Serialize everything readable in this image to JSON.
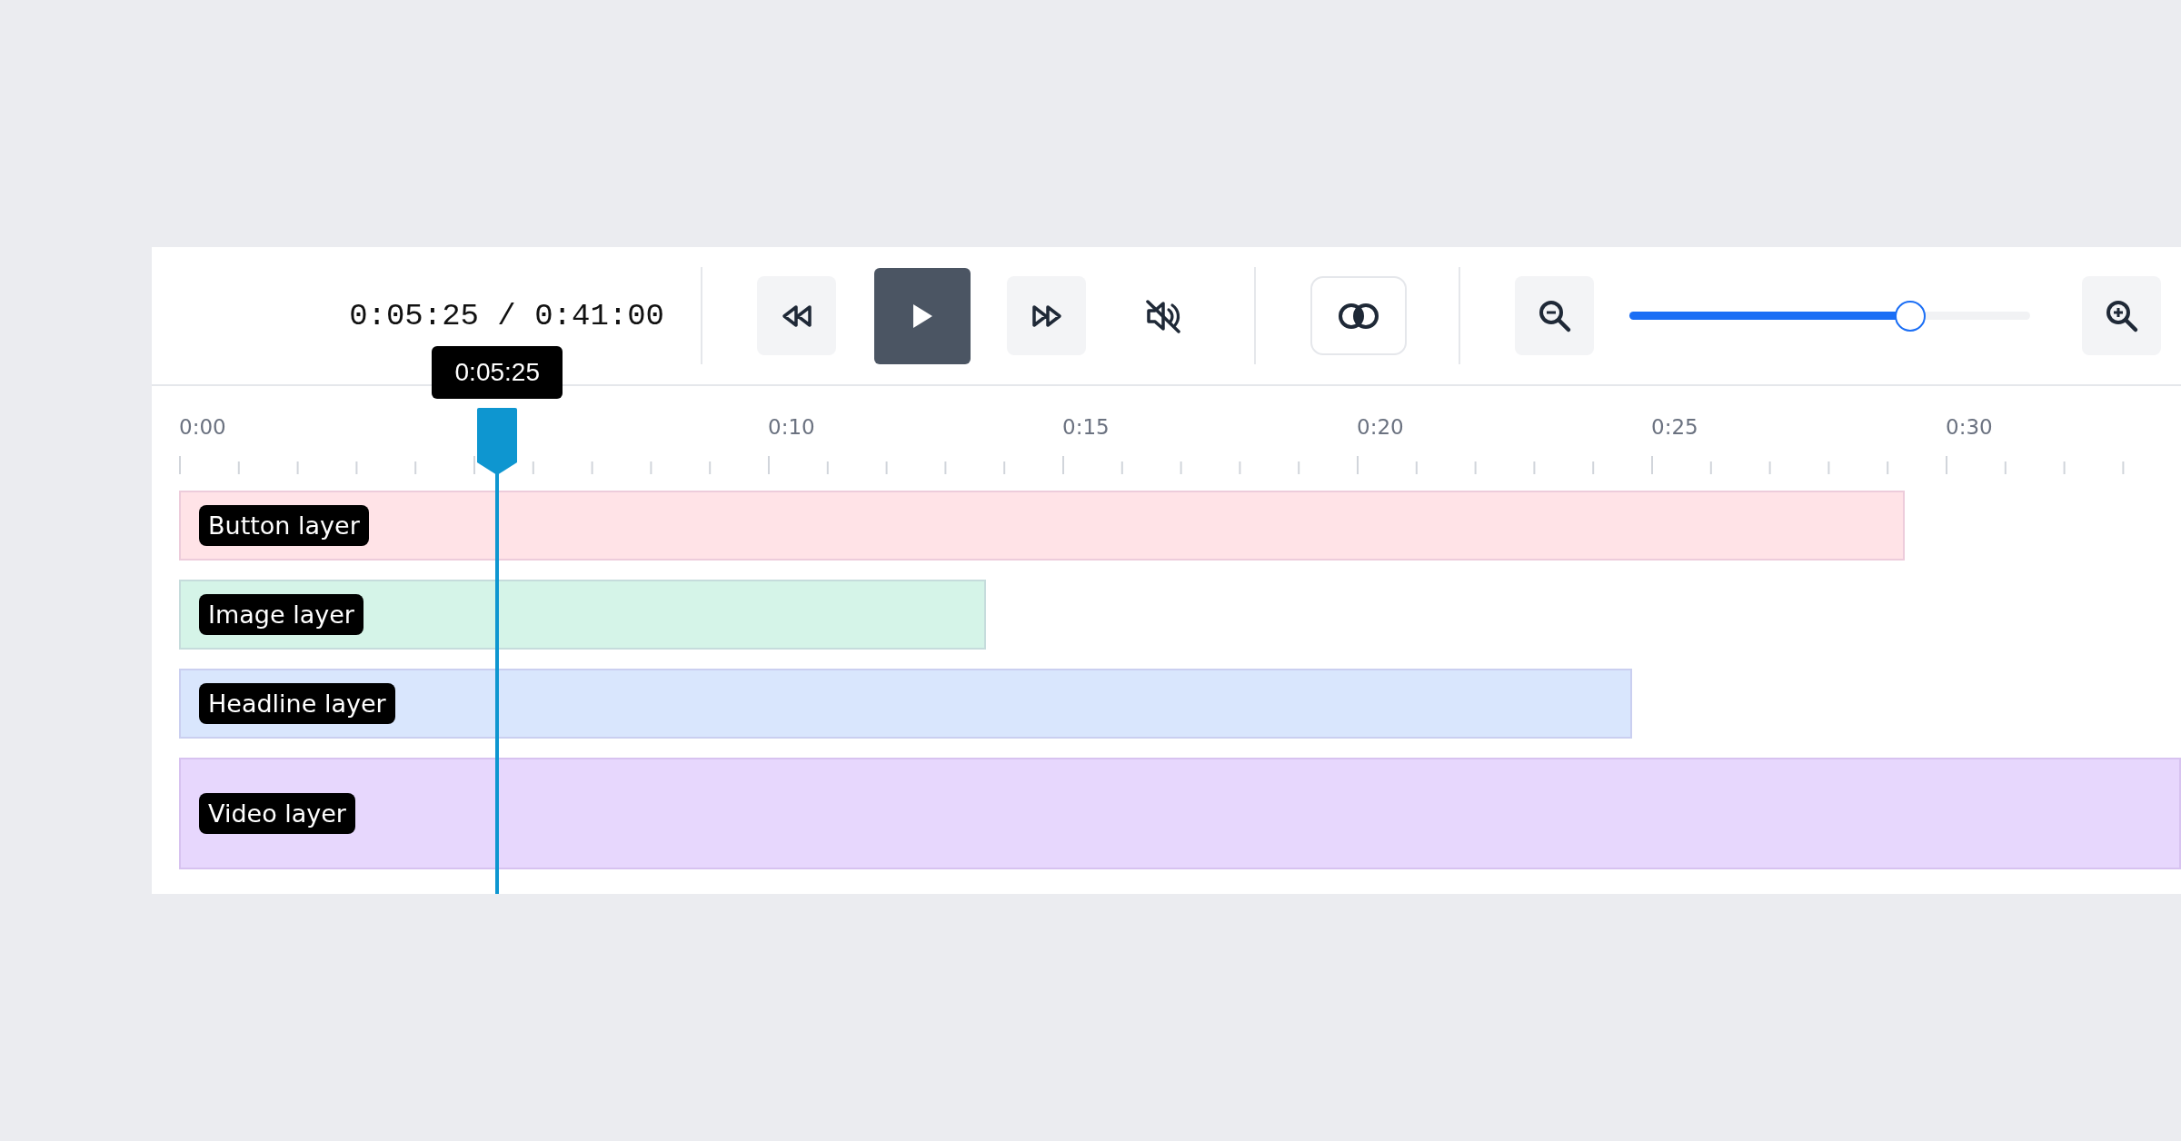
{
  "time_display": "0:05:25 / 0:41:00",
  "muted": true,
  "zoom": {
    "level": 0.7
  },
  "playhead": {
    "label": "0:05:25",
    "level": 0.159
  },
  "ruler": {
    "labels": [
      "0:00",
      "0:10",
      "0:15",
      "0:20",
      "0:25",
      "0:30"
    ]
  },
  "tracks": [
    {
      "label": "Button layer",
      "color": "#ffe3e7",
      "level": 0.862,
      "kind": "short"
    },
    {
      "label": "Image layer",
      "color": "#d5f4e8",
      "level": 0.403,
      "kind": "short"
    },
    {
      "label": "Headline layer",
      "color": "#d9e6fd",
      "level": 0.726,
      "kind": "short"
    },
    {
      "label": "Video layer",
      "color": "#e7d7fd",
      "level": 1.0,
      "kind": "tall"
    }
  ]
}
